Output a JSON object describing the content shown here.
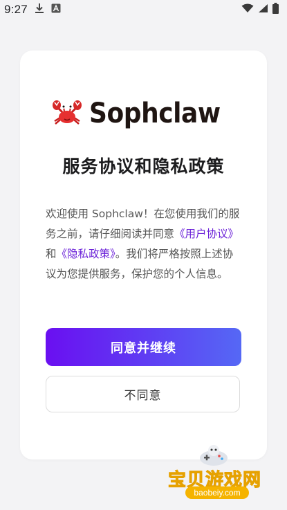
{
  "status_bar": {
    "time": "9:27",
    "icons": [
      "download-icon",
      "a-notification-icon",
      "wifi-icon",
      "signal-icon",
      "battery-icon"
    ]
  },
  "brand": {
    "logo": "crab-logo-icon",
    "name": "Sophclaw"
  },
  "dialog": {
    "title": "服务协议和隐私政策",
    "body": {
      "part1": "欢迎使用 Sophclaw！在您使用我们的服务之前，请仔细阅读并同意",
      "link_user_agreement": "《用户协议》",
      "part2": "和",
      "link_privacy_policy": "《隐私政策》",
      "part3": "。我们将严格按照上述协议为您提供服务，保护您的个人信息。"
    },
    "agree_label": "同意并继续",
    "disagree_label": "不同意"
  },
  "watermark": {
    "text": "宝贝游戏网",
    "url": "baobeiy.com"
  },
  "colors": {
    "accent_start": "#6a0ff1",
    "accent_end": "#5568f5",
    "link": "#6b21d8",
    "background": "#f3f3f5"
  }
}
